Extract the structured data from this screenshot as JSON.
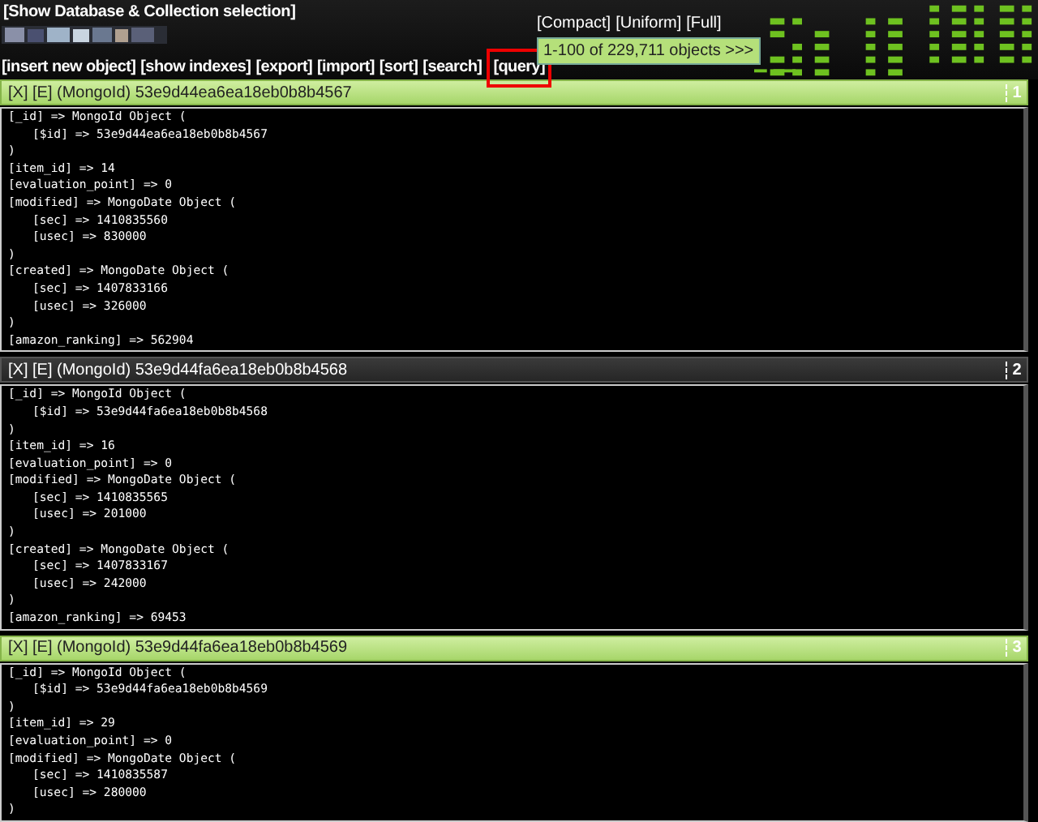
{
  "header": {
    "selection_link": "[Show Database & Collection selection]",
    "view_modes": [
      {
        "label": "[Compact]"
      },
      {
        "label": "[Uniform]"
      },
      {
        "label": "[Full]"
      }
    ],
    "pager": "1-100 of 229,711 objects >>>"
  },
  "toolbar": [
    {
      "label": "[insert new object]",
      "marked": false
    },
    {
      "label": "[show indexes]",
      "marked": false
    },
    {
      "label": "[export]",
      "marked": false
    },
    {
      "label": "[import]",
      "marked": false
    },
    {
      "label": "[sort]",
      "marked": false
    },
    {
      "label": "[search]",
      "marked": false
    },
    {
      "label": "[query]",
      "marked": true
    }
  ],
  "records": [
    {
      "title": "[X] [E] (MongoId) 53e9d44ea6ea18eb0b8b4567",
      "number": "1",
      "highlighted": true,
      "lines": [
        {
          "text": "[_id] => MongoId Object (",
          "children": [
            {
              "text": "[$id] => 53e9d44ea6ea18eb0b8b4567"
            }
          ]
        },
        {
          "text": ")"
        },
        {
          "text": "[item_id] => 14"
        },
        {
          "text": "[evaluation_point] => 0"
        },
        {
          "text": "[modified] => MongoDate Object (",
          "children": [
            {
              "text": "[sec] => 1410835560"
            },
            {
              "text": "[usec] => 830000"
            }
          ]
        },
        {
          "text": ")"
        },
        {
          "text": "[created] => MongoDate Object (",
          "children": [
            {
              "text": "[sec] => 1407833166"
            },
            {
              "text": "[usec] => 326000"
            }
          ]
        },
        {
          "text": ")"
        },
        {
          "text": "[amazon_ranking] => 562904"
        }
      ]
    },
    {
      "title": "[X] [E] (MongoId) 53e9d44fa6ea18eb0b8b4568",
      "number": "2",
      "highlighted": false,
      "lines": [
        {
          "text": "[_id] => MongoId Object (",
          "children": [
            {
              "text": "[$id] => 53e9d44fa6ea18eb0b8b4568"
            }
          ]
        },
        {
          "text": ")"
        },
        {
          "text": "[item_id] => 16"
        },
        {
          "text": "[evaluation_point] => 0"
        },
        {
          "text": "[modified] => MongoDate Object (",
          "children": [
            {
              "text": "[sec] => 1410835565"
            },
            {
              "text": "[usec] => 201000"
            }
          ]
        },
        {
          "text": ")"
        },
        {
          "text": "[created] => MongoDate Object (",
          "children": [
            {
              "text": "[sec] => 1407833167"
            },
            {
              "text": "[usec] => 242000"
            }
          ]
        },
        {
          "text": ")"
        },
        {
          "text": "[amazon_ranking] => 69453"
        }
      ]
    },
    {
      "title": "[X] [E] (MongoId) 53e9d44fa6ea18eb0b8b4569",
      "number": "3",
      "highlighted": true,
      "lines": [
        {
          "text": "[_id] => MongoId Object (",
          "children": [
            {
              "text": "[$id] => 53e9d44fa6ea18eb0b8b4569"
            }
          ]
        },
        {
          "text": ")"
        },
        {
          "text": "[item_id] => 29"
        },
        {
          "text": "[evaluation_point] => 0"
        },
        {
          "text": "[modified] => MongoDate Object (",
          "children": [
            {
              "text": "[sec] => 1410835587"
            },
            {
              "text": "[usec] => 280000"
            }
          ]
        },
        {
          "text": ")"
        }
      ]
    }
  ]
}
